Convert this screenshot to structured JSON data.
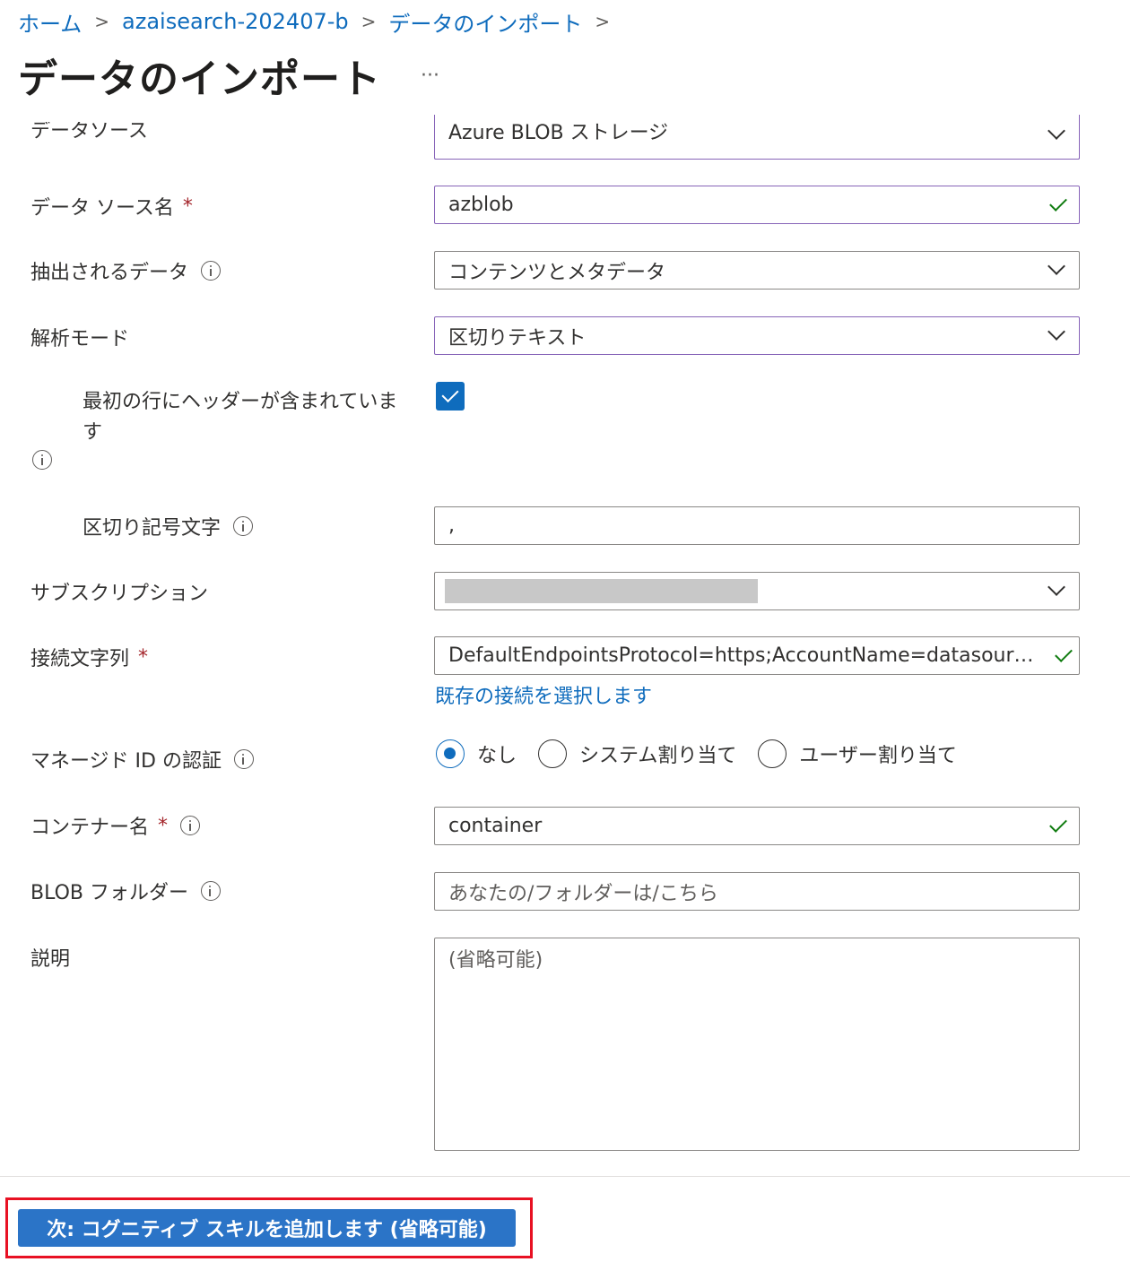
{
  "breadcrumb": {
    "home": "ホーム",
    "service": "azaisearch-202407-b",
    "current": "データのインポート"
  },
  "page": {
    "title": "データのインポート",
    "more": "···"
  },
  "form": {
    "data_source": {
      "label": "データソース",
      "value": "Azure BLOB ストレージ"
    },
    "data_source_name": {
      "label": "データ ソース名",
      "required": "*",
      "value": "azblob"
    },
    "extracted_data": {
      "label": "抽出されるデータ",
      "value": "コンテンツとメタデータ"
    },
    "parsing_mode": {
      "label": "解析モード",
      "value": "区切りテキスト"
    },
    "first_line_header": {
      "label_line1": "最初の行にヘッダーが含まれていま",
      "label_line2": "す",
      "checked": true
    },
    "delimiter": {
      "label": "区切り記号文字",
      "value": ","
    },
    "subscription": {
      "label": "サブスクリプション"
    },
    "connection_string": {
      "label": "接続文字列",
      "required": "*",
      "value": "DefaultEndpointsProtocol=https;AccountName=datasour…",
      "link": "既存の接続を選択します"
    },
    "managed_identity": {
      "label": "マネージド ID の認証",
      "options": [
        "なし",
        "システム割り当て",
        "ユーザー割り当て"
      ],
      "selected": "なし"
    },
    "container_name": {
      "label": "コンテナー名",
      "required": "*",
      "value": "container"
    },
    "blob_folder": {
      "label": "BLOB フォルダー",
      "placeholder": "あなたの/フォルダーは/こちら"
    },
    "description": {
      "label": "説明",
      "placeholder": "(省略可能)"
    }
  },
  "footer": {
    "next_button": "次: コグニティブ スキルを追加します (省略可能)"
  },
  "colors": {
    "accent": "#0f6cbd",
    "button": "#2b74c7",
    "valid": "#107c10",
    "highlight": "#e81123",
    "required": "#a4262c"
  }
}
